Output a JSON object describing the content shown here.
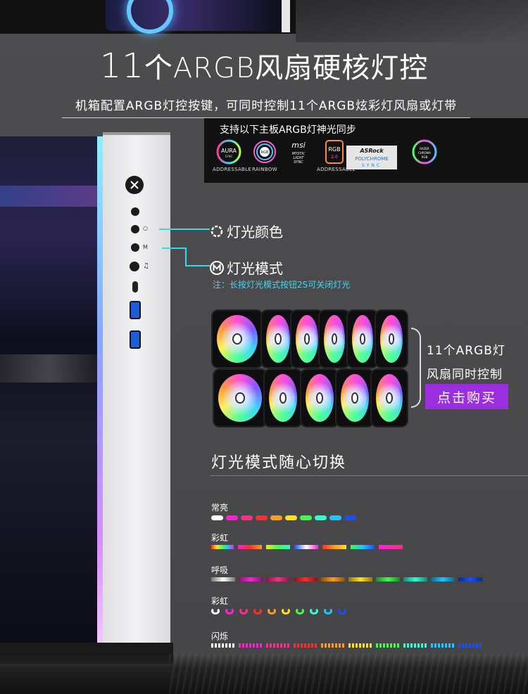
{
  "headline": {
    "number": "11",
    "text": "个ARGB风扇硬核灯控"
  },
  "subline": "机箱配置ARGB灯控按键，可同时控制11个ARGB炫彩灯风扇或灯带",
  "sync": {
    "title": "支持以下主板ARGB灯神光同步",
    "logos": [
      {
        "icon": "asus-aura-sync-logo",
        "text": "AURA",
        "sub": "SYNC",
        "caption": "ADDRESSABLE"
      },
      {
        "icon": "asus-rgb-rainbow-logo",
        "text": "RGB",
        "sub": "",
        "caption": "RAINBOW"
      },
      {
        "icon": "msi-mystic-light-logo",
        "text": "msi",
        "sub": "MYSTIC LIGHT SYNC",
        "caption": ""
      },
      {
        "icon": "gigabyte-rgb-fusion-logo",
        "text": "RGB",
        "sub": "2.0",
        "caption": "ADDRESSABLE"
      },
      {
        "icon": "asrock-polychrome-logo",
        "text": "ASRock",
        "sub": "POLYCHROME SYNC",
        "caption": ""
      },
      {
        "icon": "razer-chroma-logo",
        "text": "RAZER CHROMA",
        "sub": "RGB",
        "caption": ""
      }
    ]
  },
  "callouts": {
    "color_label": "灯光颜色",
    "mode_label": "灯光模式",
    "note": "注：长按灯光模式按钮2S可关闭灯光"
  },
  "fans": {
    "line1": "11个ARGB灯",
    "line2": "风扇同时控制",
    "buy_label": "点击购买"
  },
  "modes": {
    "title": "灯光模式随心切换",
    "items": [
      {
        "label": "常亮"
      },
      {
        "label": "彩虹"
      },
      {
        "label": "呼吸"
      },
      {
        "label": "彩虹"
      },
      {
        "label": "闪烁"
      }
    ],
    "colors": {
      "solid": [
        "#ffffff",
        "#ff1fd6",
        "#ff2d8a",
        "#ff2d2d",
        "#ff9c1a",
        "#ffe11a",
        "#3dff4a",
        "#2affd5",
        "#1ac8ff",
        "#1a4dff"
      ],
      "accent_cyan": "#35d8e6",
      "buy_purple": "#9b2fe0"
    }
  }
}
